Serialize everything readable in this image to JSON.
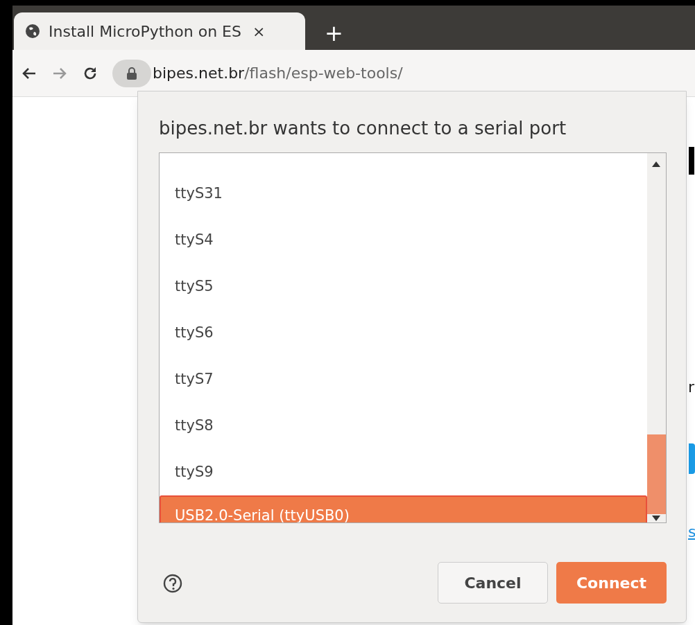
{
  "tab": {
    "title": "Install MicroPython on ES",
    "close": "×",
    "new_tab": "+"
  },
  "address_bar": {
    "host": "bipes.net.br",
    "path": "/flash/esp-web-tools/"
  },
  "dialog": {
    "title": "bipes.net.br wants to connect to a serial port",
    "ports": [
      {
        "label": "ttyS31",
        "selected": false
      },
      {
        "label": "ttyS4",
        "selected": false
      },
      {
        "label": "ttyS5",
        "selected": false
      },
      {
        "label": "ttyS6",
        "selected": false
      },
      {
        "label": "ttyS7",
        "selected": false
      },
      {
        "label": "ttyS8",
        "selected": false
      },
      {
        "label": "ttyS9",
        "selected": false
      },
      {
        "label": "USB2.0-Serial (ttyUSB0)",
        "selected": true
      }
    ],
    "buttons": [
      {
        "label": "Cancel",
        "kind": "secondary"
      },
      {
        "label": "Connect",
        "kind": "primary"
      }
    ]
  },
  "page_fragments": [
    {
      "text": "r",
      "kind": "text"
    },
    {
      "text": "s",
      "kind": "link"
    }
  ]
}
